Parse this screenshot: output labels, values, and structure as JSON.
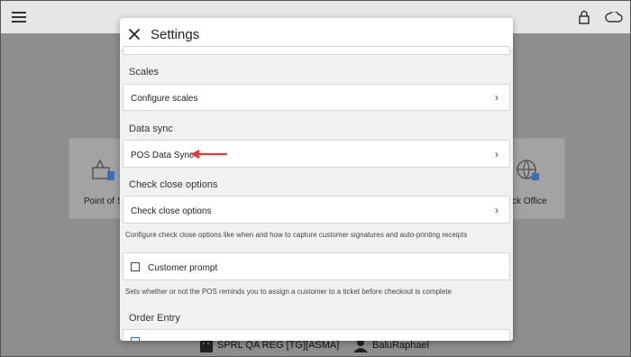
{
  "app": {
    "tiles": {
      "left_label": "Point of S",
      "right_label": "ck Office"
    },
    "bottom_bar": {
      "register": "SPRL QA REG [TG][ASMA]",
      "user": "BaluRaphael"
    }
  },
  "modal": {
    "title": "Settings",
    "sections": [
      {
        "heading": "Scales",
        "row": "Configure scales"
      },
      {
        "heading": "Data sync",
        "row": "POS Data Sync"
      },
      {
        "heading": "Check close options",
        "row": "Check close options",
        "helper": "Configure check close options like when and how to capture customer signatures and auto-printing receipts"
      },
      {
        "checkbox_label": "Customer prompt",
        "helper": "Sets whether or not the POS reminds you to assign a customer to a ticket before checkout is complete"
      },
      {
        "heading": "Order Entry"
      }
    ],
    "chevron": "›"
  },
  "colors": {
    "annotation_arrow": "#e53935",
    "overlay": "#8e8e8e",
    "modal_bg": "#f1f1f1"
  }
}
